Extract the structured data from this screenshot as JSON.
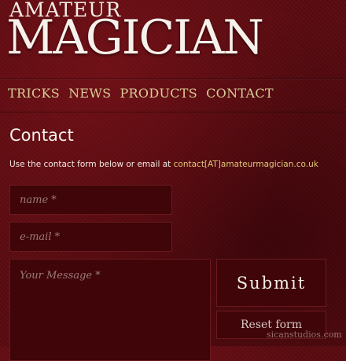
{
  "header": {
    "logo_top": "AMATEUR",
    "logo_main": "MAGICIAN"
  },
  "nav": {
    "items": [
      {
        "label": "TRICKS"
      },
      {
        "label": "NEWS"
      },
      {
        "label": "PRODUCTS"
      },
      {
        "label": "CONTACT"
      }
    ]
  },
  "main": {
    "title": "Contact",
    "intro_text": "Use the contact form below or email at ",
    "email_link": "contact[AT]amateurmagician.co.uk"
  },
  "form": {
    "name_placeholder": "name *",
    "email_placeholder": "e-mail *",
    "message_placeholder": "Your Message *",
    "submit_label": "Submit",
    "reset_label": "Reset form"
  },
  "watermark": "sicanstudios.com",
  "colors": {
    "background": "#5a0b10",
    "nav_text": "#d9cc98",
    "link": "#e0c978",
    "field_bg": "#3f0509"
  }
}
